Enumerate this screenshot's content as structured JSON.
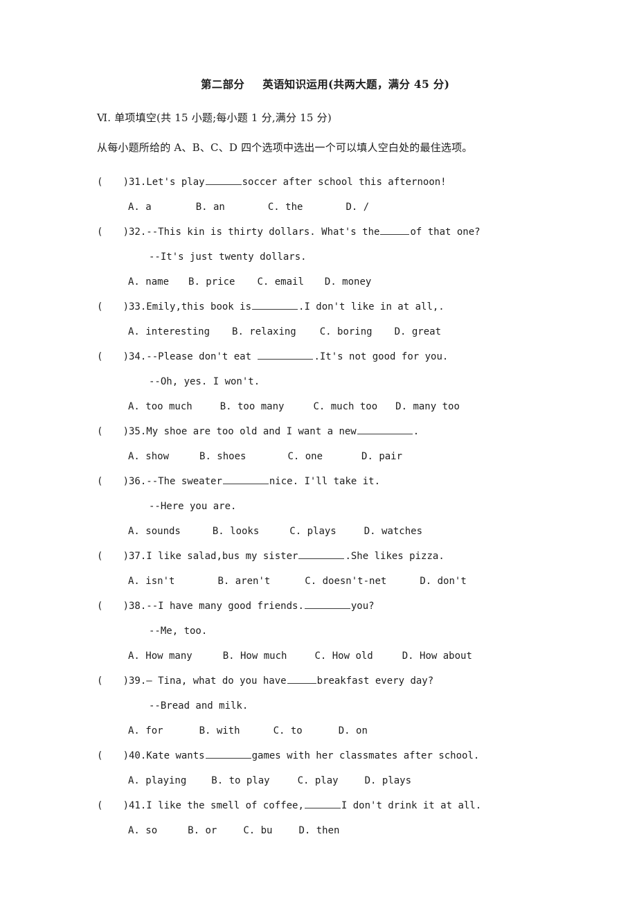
{
  "document": {
    "section_title": {
      "part_label": "第二部分",
      "title": "英语知识运用(共两大题，满分 45 分)"
    },
    "sub_headings": [
      "Ⅵ. 单项填空(共 15 小题;每小题 1 分,满分 15 分)",
      "从每小题所给的 A、B、C、D 四个选项中选出一个可以填人空白处的最住选项。"
    ],
    "questions": [
      {
        "number": "31.",
        "stem_pre": "Let's play",
        "blank": "b-mid",
        "stem_post": "soccer  after  school  this  afternoon!",
        "continuation": null,
        "options": [
          "A. a",
          "B. an",
          "C. the",
          "D. /"
        ],
        "opt_gaps": [
          64,
          62,
          62
        ]
      },
      {
        "number": "32.",
        "stem_pre": "--This  kin  is  thirty dollars.  What's the",
        "blank": "b-short",
        "stem_post": "of that one?",
        "continuation": "--It's  just  twenty  dollars.",
        "options": [
          "A. name",
          "B. price",
          "C. email",
          "D. money"
        ],
        "opt_gaps": [
          28,
          32,
          30
        ]
      },
      {
        "number": "33.",
        "stem_pre": "Emily,this  book  is",
        "blank": "b-long",
        "stem_post": ".I don't  like  in at all,.",
        "continuation": null,
        "options": [
          "A. interesting",
          "B. relaxing",
          "C. boring",
          "D. great"
        ],
        "opt_gaps": [
          32,
          34,
          32
        ]
      },
      {
        "number": "34.",
        "stem_pre": "--Please don't  eat ",
        "blank": "b-xlong",
        "stem_post": ".It's  not  good  for  you.",
        "continuation": "--Oh, yes. I won't.",
        "options": [
          "A. too much",
          "B. too many",
          "C. much too",
          "D. many too"
        ],
        "opt_gaps": [
          40,
          42,
          26
        ]
      },
      {
        "number": "35.",
        "stem_pre": "My  shoe  are  too  old  and  I want  a  new",
        "blank": "b-xlong",
        "stem_post": ".",
        "continuation": null,
        "options": [
          "A. show",
          "B. shoes",
          "C. one",
          "D. pair"
        ],
        "opt_gaps": [
          44,
          60,
          56
        ]
      },
      {
        "number": "36.",
        "stem_pre": "--The sweater",
        "blank": "b-long",
        "stem_post": "nice. I'll take it.",
        "continuation": "--Here  you  are.",
        "options": [
          "A. sounds",
          "B. looks",
          "C. plays",
          "D. watches"
        ],
        "opt_gaps": [
          46,
          44,
          40
        ]
      },
      {
        "number": "37.",
        "stem_pre": "I like  salad,bus  my  sister",
        "blank": "b-long",
        "stem_post": ".She likes pizza.",
        "continuation": null,
        "options": [
          "A. isn't",
          "B. aren't",
          "C. doesn't-net",
          "D. don't"
        ],
        "opt_gaps": [
          62,
          50,
          48
        ]
      },
      {
        "number": "38.",
        "stem_pre": "--I have many good friends.",
        "blank": "b-long",
        "stem_post": "you?",
        "continuation": "--Me, too.",
        "options": [
          "A. How many",
          "B. How much",
          "C. How old",
          "D. How about"
        ],
        "opt_gaps": [
          44,
          40,
          42
        ]
      },
      {
        "number": "39.",
        "stem_pre": "— Tina,  what  do  you  have",
        "blank": "b-short",
        "stem_post": "breakfast  every  day?",
        "continuation": "--Bread  and  milk.",
        "options": [
          "A. for",
          "B. with",
          "C. to",
          "D. on"
        ],
        "opt_gaps": [
          52,
          48,
          52
        ]
      },
      {
        "number": "40.",
        "stem_pre": "Kate wants",
        "blank": "b-long",
        "stem_post": "games  with  her classmates  after  school.",
        "continuation": null,
        "options": [
          "A. playing",
          "B. to play",
          "C. play",
          "D. plays"
        ],
        "opt_gaps": [
          36,
          40,
          38
        ]
      },
      {
        "number": "41.",
        "stem_pre": "I like the smell of coffee,",
        "blank": "b-mid",
        "stem_post": "I don't  drink  it  at  all.",
        "continuation": null,
        "options": [
          "A.  so",
          "B. or",
          "C. bu",
          "D. then"
        ],
        "opt_gaps": [
          44,
          38,
          38
        ]
      }
    ],
    "marks": {
      "left_paren": "(",
      "right_paren": ")"
    }
  }
}
